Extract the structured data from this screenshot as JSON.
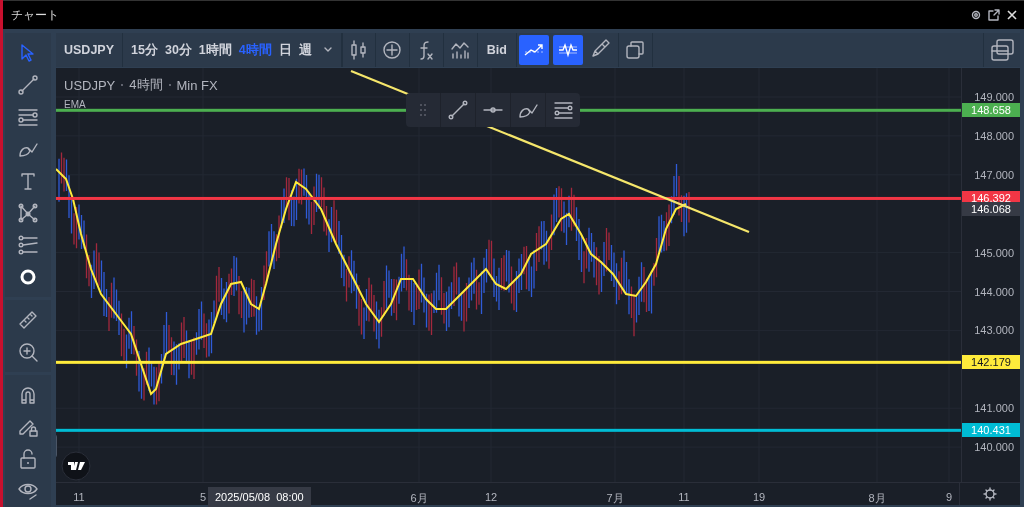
{
  "window": {
    "title": "チャート"
  },
  "tool_groups": [
    [
      {
        "kind": "cursor",
        "selected": true
      },
      {
        "kind": "line",
        "selected": false
      },
      {
        "kind": "hlines",
        "selected": false
      },
      {
        "kind": "brush",
        "selected": false
      },
      {
        "kind": "text",
        "selected": false
      },
      {
        "kind": "pattern",
        "selected": false
      },
      {
        "kind": "projection",
        "selected": false
      },
      {
        "kind": "circle",
        "selected": false
      }
    ],
    [
      {
        "kind": "ruler",
        "selected": false
      },
      {
        "kind": "zoom",
        "selected": false
      }
    ],
    [
      {
        "kind": "magnet",
        "selected": false
      },
      {
        "kind": "pencil-lock",
        "selected": false
      },
      {
        "kind": "lock",
        "selected": false
      },
      {
        "kind": "eye",
        "selected": false
      }
    ]
  ],
  "toolbar": {
    "symbol": "USDJPY",
    "intervals": [
      {
        "label": "15分",
        "selected": false
      },
      {
        "label": "30分",
        "selected": false
      },
      {
        "label": "1時間",
        "selected": false
      },
      {
        "label": "4時間",
        "selected": true
      },
      {
        "label": "日",
        "selected": false
      },
      {
        "label": "週",
        "selected": false
      }
    ],
    "buttons": [
      {
        "kind": "candles",
        "active": false
      },
      {
        "kind": "add",
        "active": false
      },
      {
        "kind": "fx",
        "active": false
      },
      {
        "kind": "indicators",
        "active": false
      },
      {
        "kind": "text",
        "label": "Bid",
        "active": false
      },
      {
        "kind": "trend",
        "active": true
      },
      {
        "kind": "wave",
        "active": true
      },
      {
        "kind": "brush",
        "active": false
      },
      {
        "kind": "copy",
        "active": false
      }
    ]
  },
  "legend": {
    "parts": [
      "USDJPY",
      "4時間",
      "Min FX"
    ],
    "indicator": "EMA"
  },
  "floating_toolbar": {
    "tools": [
      {
        "kind": "line"
      },
      {
        "kind": "hray"
      },
      {
        "kind": "brush"
      },
      {
        "kind": "hlines"
      }
    ]
  },
  "price_axis": {
    "ticks": [
      "149.000",
      "148.000",
      "147.000",
      "145.000",
      "144.000",
      "143.000",
      "141.000",
      "140.000"
    ]
  },
  "price_lines": [
    {
      "price": "148.658",
      "color": "#4caf50"
    },
    {
      "price": "146.392",
      "color": "#f23645"
    },
    {
      "price": "142.179",
      "color": "#ffeb3b"
    },
    {
      "price": "140.431",
      "color": "#00bcd4"
    }
  ],
  "current_price": "146.068",
  "time_axis": {
    "labels": [
      "11",
      "5",
      "6月",
      "12",
      "7月",
      "11",
      "19",
      "8月",
      "9"
    ],
    "crosshair_label": "2025/05/08  08:00"
  }
}
